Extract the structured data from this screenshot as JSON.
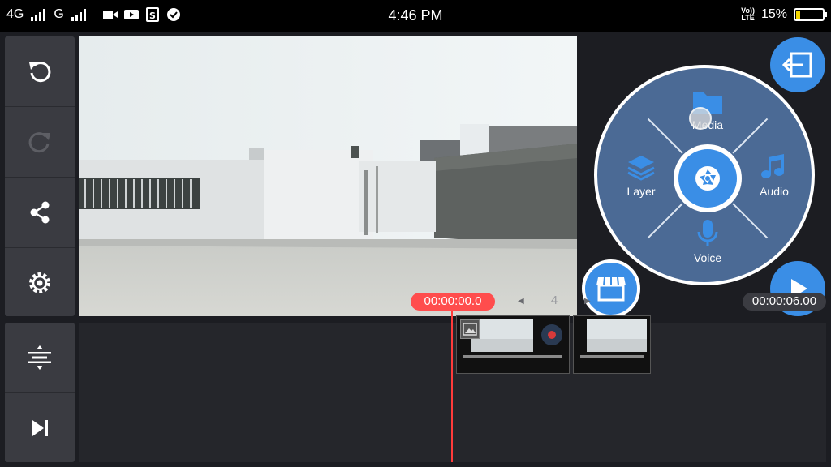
{
  "status_bar": {
    "network_1": "4G",
    "network_2": "G",
    "time": "4:46 PM",
    "volte_top": "Vo))",
    "volte_bottom": "LTE",
    "battery_percent": "15%",
    "battery_level": 0.15,
    "icons": [
      "signal-icon",
      "signal-icon",
      "video-camera-icon",
      "video-icon",
      "app-s-icon",
      "check-circle-icon"
    ]
  },
  "toolbar": {
    "undo_icon": "undo-icon",
    "redo_icon": "redo-icon",
    "share_icon": "share-icon",
    "settings_icon": "settings-gear-icon",
    "timeline_adjust_icon": "timeline-adjust-icon",
    "skip_end_icon": "skip-to-end-icon"
  },
  "radial_menu": {
    "media": "Media",
    "layer": "Layer",
    "audio": "Audio",
    "voice": "Voice",
    "center_icon": "camera-shutter-icon"
  },
  "timeline": {
    "current_time": "00:00:00.0",
    "total_time": "00:00:06.00",
    "frame_number": "4"
  },
  "colors": {
    "accent_blue": "#3a8ee6",
    "radial_bg": "#4b6a95",
    "playhead_red": "#ff4d4d",
    "panel_bg": "#3a3b41"
  }
}
